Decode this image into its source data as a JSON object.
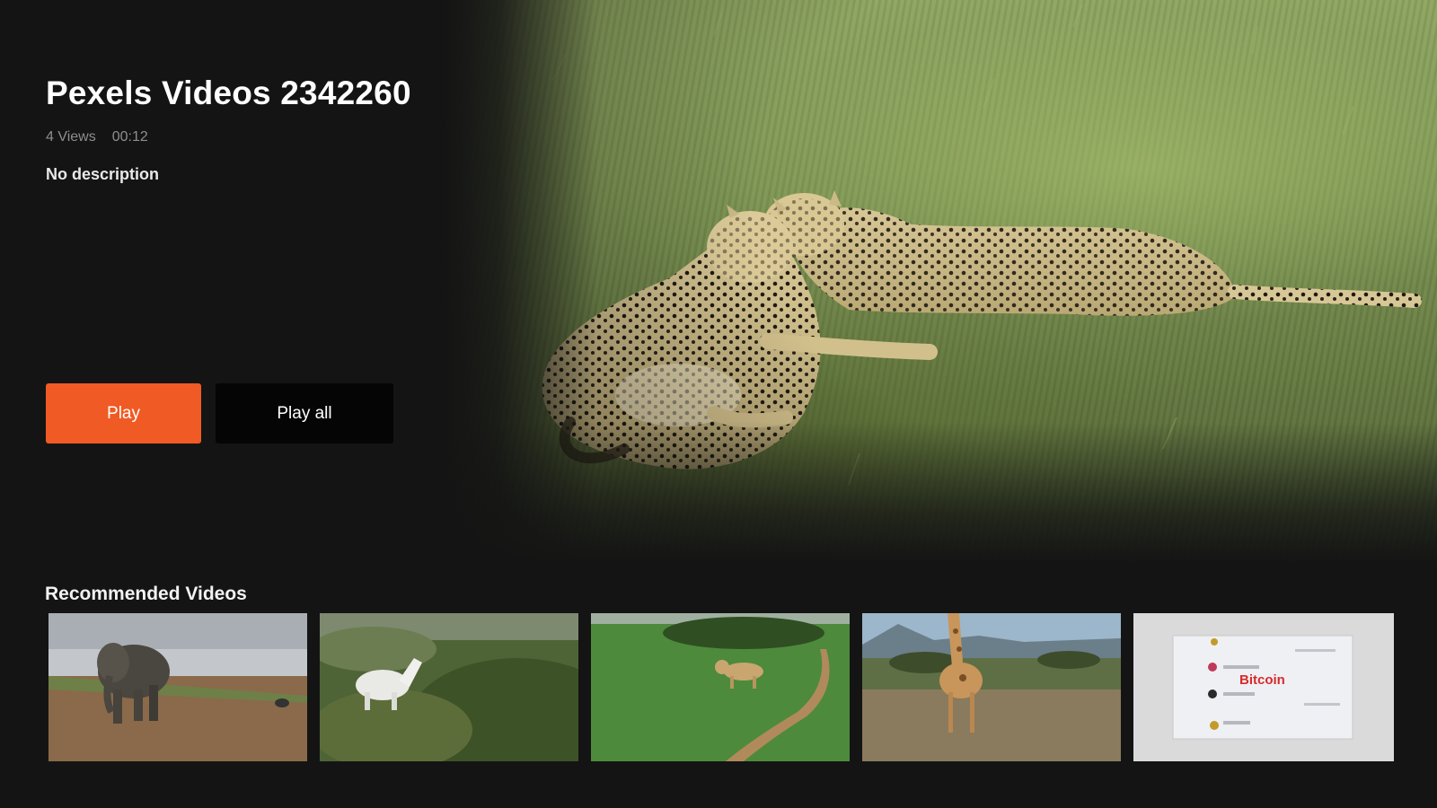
{
  "video": {
    "title": "Pexels Videos 2342260",
    "views": "4 Views",
    "duration": "00:12",
    "description": "No description"
  },
  "actions": {
    "play_label": "Play",
    "play_all_label": "Play all"
  },
  "recommended": {
    "heading": "Recommended Videos",
    "items": [
      {
        "subject": "elephant",
        "overlay_text": ""
      },
      {
        "subject": "white-horse",
        "overlay_text": ""
      },
      {
        "subject": "lioness-on-path",
        "overlay_text": ""
      },
      {
        "subject": "giraffe",
        "overlay_text": ""
      },
      {
        "subject": "bitcoin-screen",
        "overlay_text": "Bitcoin"
      }
    ]
  },
  "colors": {
    "background": "#141414",
    "accent": "#f05a24",
    "secondary_button": "#050505"
  },
  "hero": {
    "subject": "two-cheetahs-on-grass"
  }
}
